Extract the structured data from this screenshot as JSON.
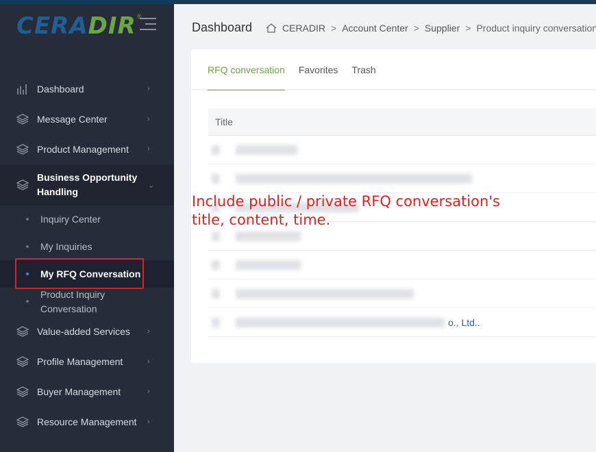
{
  "brand": {
    "logo_part1": "CERA",
    "logo_part2": "DIR",
    "registered": "®"
  },
  "sidebar": {
    "items": [
      {
        "label": "Dashboard",
        "icon": "bar-chart-icon"
      },
      {
        "label": "Message Center",
        "icon": "layers-icon"
      },
      {
        "label": "Product Management",
        "icon": "layers-icon"
      },
      {
        "label": "Business Opportunity Handling",
        "icon": "layers-icon"
      },
      {
        "label": "Value-added Services",
        "icon": "layers-icon"
      },
      {
        "label": "Profile Management",
        "icon": "layers-icon"
      },
      {
        "label": "Buyer Management",
        "icon": "layers-icon"
      },
      {
        "label": "Resource Management",
        "icon": "layers-icon"
      }
    ],
    "submenu": [
      {
        "label": "Inquiry Center"
      },
      {
        "label": "My Inquiries"
      },
      {
        "label": "My RFQ Conversation"
      },
      {
        "label": "Product Inquiry Conversation"
      }
    ]
  },
  "header": {
    "title": "Dashboard",
    "breadcrumb": [
      "CERADIR",
      "Account Center",
      "Supplier",
      "Product inquiry conversation"
    ],
    "separator": ">"
  },
  "tabs": [
    "RFQ conversation",
    "Favorites",
    "Trash"
  ],
  "table": {
    "column_title": "Title",
    "last_row_visible_text": "o., Ltd.."
  },
  "annotation": {
    "line1": "Include public / private RFQ conversation's",
    "line2": "title, content, time."
  },
  "colors": {
    "accent": "#6aa642",
    "sidebar_bg": "#272c3a",
    "annotation": "#e0211f"
  }
}
